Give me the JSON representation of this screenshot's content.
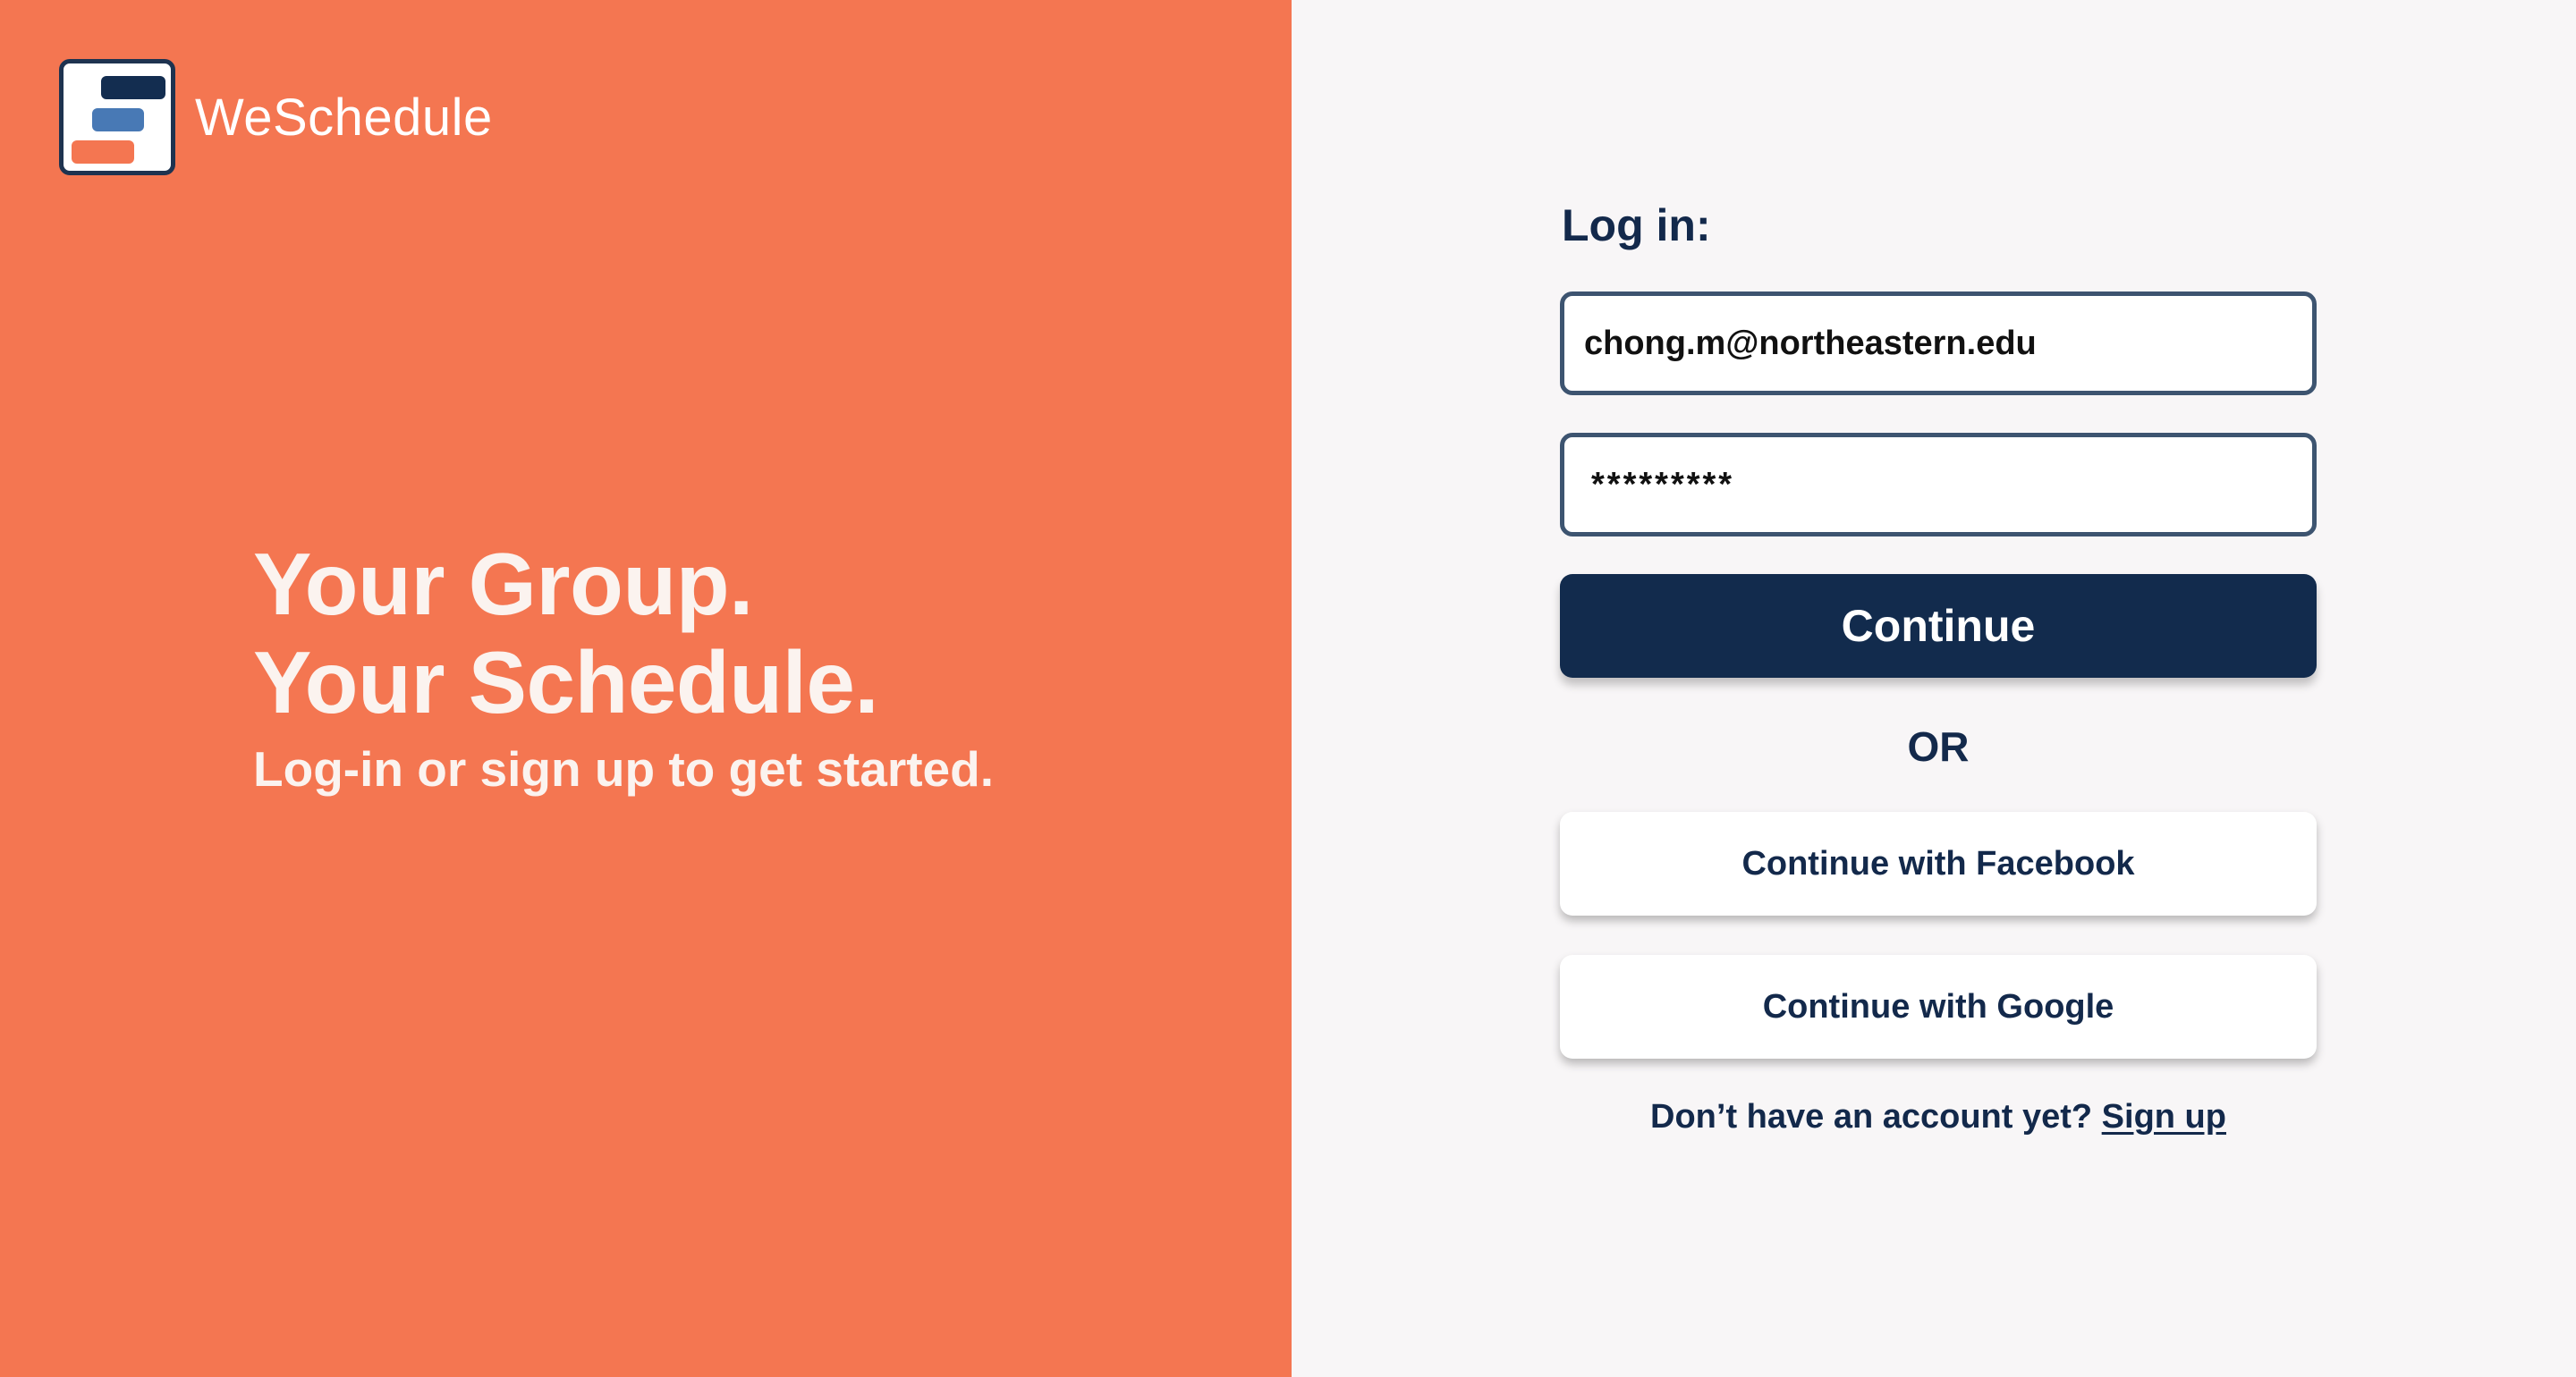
{
  "brand": {
    "name": "WeSchedule",
    "logo_icon": "stacked-bars-logo-icon"
  },
  "hero": {
    "line1": "Your Group.",
    "line2": "Your Schedule.",
    "subtitle": "Log-in or sign up to get started."
  },
  "login": {
    "title": "Log in:",
    "email_value": "chong.m@northeastern.edu",
    "password_value": "*********",
    "continue_label": "Continue",
    "or_label": "OR",
    "facebook_label": "Continue with Facebook",
    "google_label": "Continue with Google",
    "signup_prompt": "Don’t have an account yet?",
    "signup_link": "Sign up"
  },
  "colors": {
    "accent_orange": "#F47651",
    "navy": "#122B4D",
    "light_bg": "#F8F6F7",
    "logo_blue": "#4879B5"
  }
}
